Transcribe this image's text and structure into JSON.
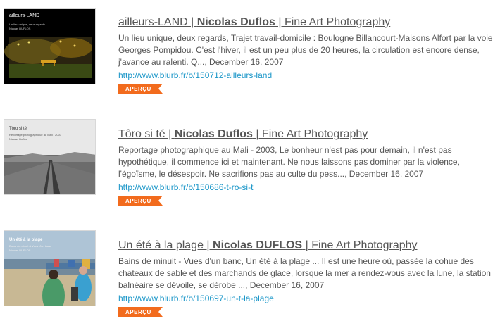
{
  "results": [
    {
      "thumb": {
        "title": "ailleurs-LAND",
        "subtitle": "Un lieu unique, deux regards",
        "author": "Nicolas DUFLOS"
      },
      "title_pre": "ailleurs-LAND | ",
      "title_author": "Nicolas Duflos",
      "title_post": " | Fine Art Photography",
      "description": "Un lieu unique, deux regards, Trajet travail-domicile : Boulogne Billancourt-Maisons Alfort par la voie Georges Pompidou. C'est l'hiver, il est un peu plus de 20 heures, la circulation est encore dense, j'avance au ralenti. Q..., December 16, 2007",
      "url": "http://www.blurb.fr/b/150712-ailleurs-land",
      "button": "APERÇU"
    },
    {
      "thumb": {
        "title": "Tôro si té",
        "subtitle": "Reportage photographique au Mali - 2003",
        "author": "Nicolas Duflos"
      },
      "title_pre": "Tôro si té | ",
      "title_author": "Nicolas Duflos",
      "title_post": " | Fine Art Photography",
      "description": "Reportage photographique au Mali - 2003, Le bonheur n'est pas pour demain, il n'est pas hypothétique, il commence ici et maintenant. Ne nous laissons pas dominer par la violence, l'égoïsme, le désespoir. Ne sacrifions pas au culte du pess..., December 16, 2007",
      "url": "http://www.blurb.fr/b/150686-t-ro-si-t",
      "button": "APERÇU"
    },
    {
      "thumb": {
        "title": "Un été à la plage",
        "subtitle": "Bains de minuit & Vues d'un banc",
        "author": "Nicolas DUFLOS"
      },
      "title_pre": "Un été à la plage | ",
      "title_author": "Nicolas DUFLOS",
      "title_post": " | Fine Art Photography",
      "description": "Bains de minuit - Vues d'un banc, Un été à la plage ... Il est une heure où, passée la cohue des chateaux de sable et des marchands de glace, lorsque la mer a rendez-vous avec la lune, la station balnéaire se dévoile, se dérobe ..., December 16, 2007",
      "url": "http://www.blurb.fr/b/150697-un-t-la-plage",
      "button": "APERÇU"
    }
  ]
}
